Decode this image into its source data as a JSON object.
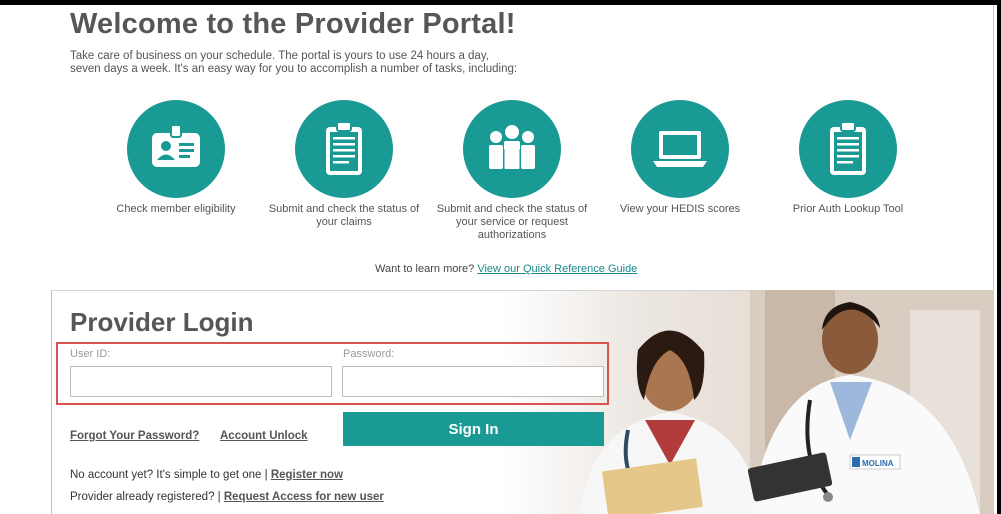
{
  "welcome": {
    "title": "Welcome to the Provider Portal!",
    "intro_line1": "Take care of business on your schedule. The portal is yours to use 24 hours a day,",
    "intro_line2": "seven days a week. It's an easy way for you to accomplish a number of tasks, including:"
  },
  "tasks": [
    {
      "icon": "id-card-icon",
      "label": "Check member eligibility"
    },
    {
      "icon": "clipboard-icon",
      "label": "Submit and check the status of your claims"
    },
    {
      "icon": "people-icon",
      "label": "Submit and check the status of your service or request authorizations"
    },
    {
      "icon": "laptop-icon",
      "label": "View your HEDIS scores"
    },
    {
      "icon": "clipboard-icon",
      "label": "Prior Auth Lookup Tool"
    }
  ],
  "learn_more": {
    "prefix": "Want to learn more?",
    "link": "View our Quick Reference Guide"
  },
  "login": {
    "title": "Provider Login",
    "user_id_label": "User ID:",
    "user_id_value": "",
    "password_label": "Password:",
    "password_value": "",
    "sign_in_label": "Sign In",
    "forgot_password": "Forgot Your Password?",
    "account_unlock": "Account Unlock",
    "no_account_text": "No account yet? It's simple to get one |",
    "register_link": "Register now",
    "already_registered_text": "Provider already registered? |",
    "request_access_link": "Request Access for new user"
  },
  "hero": {
    "badge_text": "MOLINA"
  },
  "colors": {
    "teal": "#1a9a95",
    "link_teal": "#1a8a8a",
    "highlight_red": "#d9534f",
    "heading_gray": "#565656"
  }
}
